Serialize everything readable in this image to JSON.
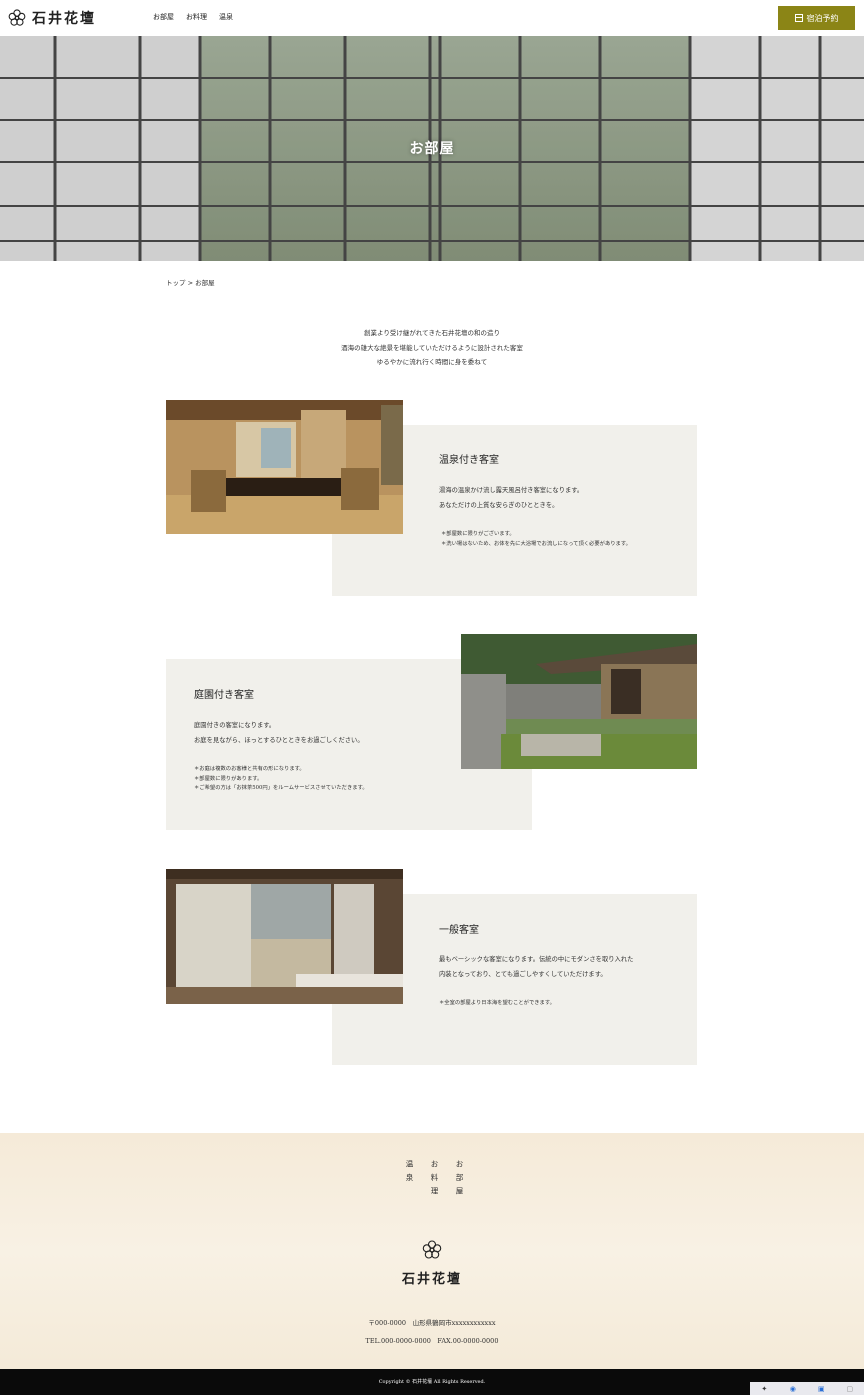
{
  "header": {
    "brand": "石井花壇",
    "nav": [
      "お部屋",
      "お料理",
      "温泉"
    ],
    "reserve_label": "宿泊予約"
  },
  "hero": {
    "title": "お部屋"
  },
  "breadcrumb": "トップ > お部屋",
  "intro": {
    "lines": [
      "創業より受け継がれてきた石井花壇の和の造り",
      "酒海の雄大な絶景を堪能していただけるように設計された客室",
      "ゆるやかに流れ行く時間に身を委ねて"
    ]
  },
  "rooms": [
    {
      "title": "温泉付き客室",
      "desc": [
        "湯海の温泉かけ流し露天風呂付き客室になります。",
        "あなただけの上質な安らぎのひとときを。"
      ],
      "notes": [
        "＊部屋数に限りがございます。",
        "＊洗い場はないため、お体を先に大浴場でお流しになって頂く必要があります。"
      ]
    },
    {
      "title": "庭園付き客室",
      "desc": [
        "庭園付きの客室になります。",
        "お庭を見ながら、ほっとするひとときをお過ごしください。"
      ],
      "notes": [
        "＊お庭は複数のお客様と共有の形になります。",
        "＊部屋数に限りがあります。",
        "＊ご希望の方は「お抹茶500円」をルームサービスさせていただきます。"
      ]
    },
    {
      "title": "一般客室",
      "desc": [
        "最もベーシックな客室になります。伝統の中にモダンさを取り入れた",
        "内装となっており、とても過ごしやすくしていただけます。"
      ],
      "notes": [
        "＊全室の部屋より日本海を望むことができます。"
      ]
    }
  ],
  "footer": {
    "nav": [
      "温泉",
      "お料理",
      "お部屋"
    ],
    "brand": "石井花壇",
    "address": "〒000-0000　山形県鶴岡市xxxxxxxxxxxx",
    "tel": "TEL.000-0000-0000　FAX.00-0000-0000",
    "copyright": "Copyright © 石井花壇 All Rights Reserved."
  },
  "colors": {
    "accent": "#8b8516",
    "panel": "#f1f0eb",
    "footer_bg": "#f5ead8"
  }
}
